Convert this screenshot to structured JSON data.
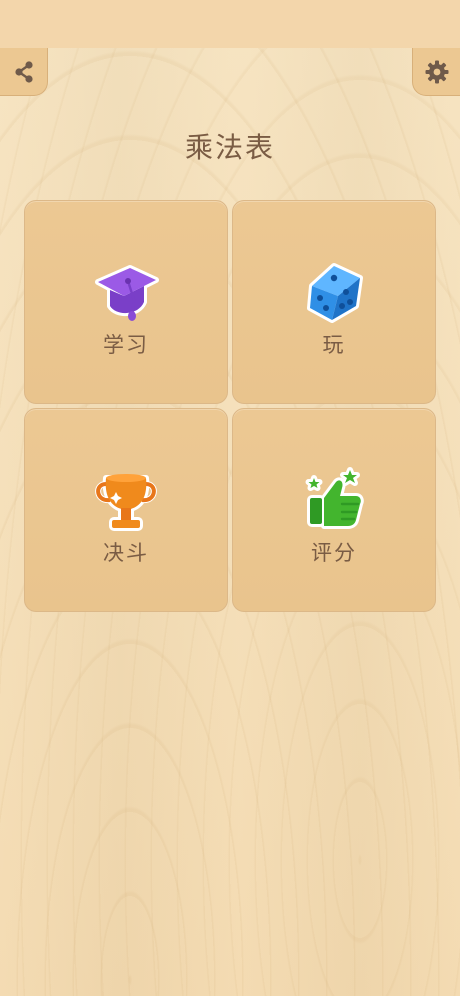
{
  "header": {
    "title": "乘法表",
    "share_icon": "share-icon",
    "settings_icon": "gear-icon"
  },
  "menu": {
    "items": [
      {
        "label": "学习",
        "icon": "graduation-cap-icon",
        "icon_color": "#8a4bd6"
      },
      {
        "label": "玩",
        "icon": "dice-icon",
        "icon_color": "#2f8fe6"
      },
      {
        "label": "决斗",
        "icon": "trophy-icon",
        "icon_color": "#f08a1c"
      },
      {
        "label": "评分",
        "icon": "thumbs-up-icon",
        "icon_color": "#43b52e"
      }
    ]
  },
  "colors": {
    "background": "#f4dcb2",
    "tile": "#eac68f",
    "text": "#7a5c44"
  }
}
